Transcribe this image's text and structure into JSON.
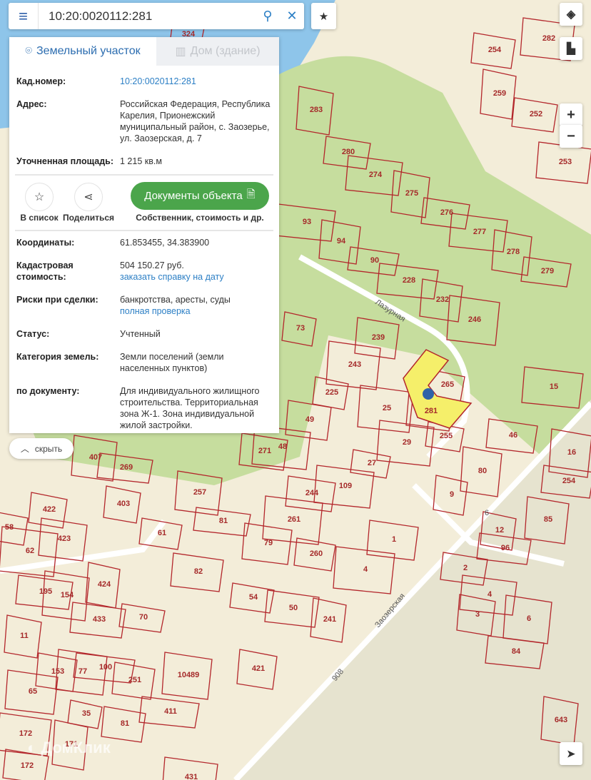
{
  "search": {
    "value": "10:20:0020112:281"
  },
  "tabs": [
    {
      "label": "Земельный участок",
      "active": true
    },
    {
      "label": "Дом (здание)",
      "active": false
    }
  ],
  "info": [
    {
      "key": "Кад.номер:",
      "value": "10:20:0020112:281",
      "link": true
    },
    {
      "key": "Адрес:",
      "value": "Российская Федерация, Республика Карелия, Прионежский муниципальный район, с. Заозерье, ул. Заозерская, д. 7"
    },
    {
      "key": "Уточненная площадь:",
      "value": "1 215 кв.м"
    }
  ],
  "actions": {
    "list": "В список",
    "share": "Поделиться",
    "docs": "Документы объекта",
    "docs_sub": "Собственник, стоимость и др."
  },
  "details": [
    {
      "key": "Координаты:",
      "value": "61.853455, 34.383900"
    },
    {
      "key": "Кадастровая стоимость:",
      "value": "504 150.27 руб.",
      "link": "заказать справку на дату"
    },
    {
      "key": "Риски при сделки:",
      "value": "банкротства, аресты, суды",
      "link": "полная проверка"
    },
    {
      "key": "Статус:",
      "value": "Учтенный"
    },
    {
      "key": "Категория земель:",
      "value": "Земли поселений (земли населенных пунктов)"
    },
    {
      "key": "по документу:",
      "value": "Для индивидуального жилищного строительства. Территориальная зона Ж-1. Зона индивидуальной жилой застройки."
    }
  ],
  "hide_label": "скрыть",
  "zoom": {
    "in": "+",
    "out": "−"
  },
  "watermark": "ДомКлик",
  "map": {
    "colors": {
      "land": "#f3edd9",
      "forest": "#c6dd9e",
      "water": "#8ec5ea",
      "boundary": "#b3262b",
      "selected": "#f5ef6a",
      "marker": "#2f62a8"
    },
    "selected_parcel": "281",
    "streets": [
      "Лазурная",
      "Заозерская",
      "908",
      "6"
    ],
    "parcels": [
      "324",
      "254",
      "282",
      "259",
      "252",
      "253",
      "283",
      "280",
      "274",
      "275",
      "276",
      "277",
      "278",
      "279",
      "93",
      "94",
      "90",
      "228",
      "232",
      "246",
      "73",
      "239",
      "243",
      "225",
      "49",
      "25",
      "265",
      "281",
      "29",
      "255",
      "271",
      "48",
      "27",
      "244",
      "109",
      "80",
      "46",
      "15",
      "16",
      "254",
      "9",
      "85",
      "96",
      "12",
      "407",
      "269",
      "403",
      "257",
      "81",
      "422",
      "423",
      "62",
      "58",
      "79",
      "261",
      "260",
      "1",
      "4",
      "61",
      "82",
      "424",
      "54",
      "50",
      "241",
      "70",
      "433",
      "11",
      "154",
      "195",
      "3",
      "6",
      "84",
      "421",
      "10489",
      "411",
      "153",
      "77",
      "100",
      "251",
      "65",
      "35",
      "81",
      "172",
      "171",
      "172",
      "431",
      "643",
      "2",
      "4"
    ]
  }
}
